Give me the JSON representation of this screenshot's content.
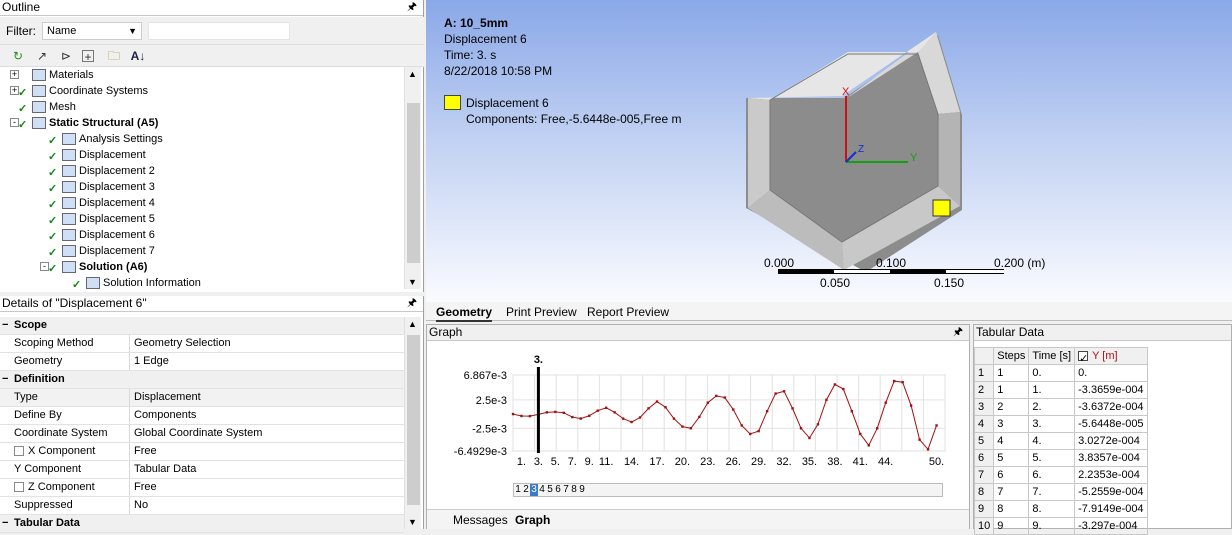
{
  "outline": {
    "title": "Outline",
    "filter_label": "Filter:",
    "filter_value": "Name",
    "tree": [
      {
        "label": "Materials",
        "bold": false,
        "level": 1,
        "expander": "+",
        "check": false
      },
      {
        "label": "Coordinate Systems",
        "bold": false,
        "level": 1,
        "expander": "+",
        "check": true
      },
      {
        "label": "Mesh",
        "bold": false,
        "level": 1,
        "expander": "",
        "check": true
      },
      {
        "label": "Static Structural (A5)",
        "bold": true,
        "level": 1,
        "expander": "-",
        "check": true
      },
      {
        "label": "Analysis Settings",
        "bold": false,
        "level": 2,
        "expander": "",
        "check": true
      },
      {
        "label": "Displacement",
        "bold": false,
        "level": 2,
        "expander": "",
        "check": true
      },
      {
        "label": "Displacement 2",
        "bold": false,
        "level": 2,
        "expander": "",
        "check": true
      },
      {
        "label": "Displacement 3",
        "bold": false,
        "level": 2,
        "expander": "",
        "check": true
      },
      {
        "label": "Displacement 4",
        "bold": false,
        "level": 2,
        "expander": "",
        "check": true
      },
      {
        "label": "Displacement 5",
        "bold": false,
        "level": 2,
        "expander": "",
        "check": true
      },
      {
        "label": "Displacement 6",
        "bold": false,
        "level": 2,
        "expander": "",
        "check": true
      },
      {
        "label": "Displacement 7",
        "bold": false,
        "level": 2,
        "expander": "",
        "check": true
      },
      {
        "label": "Solution (A6)",
        "bold": true,
        "level": 2,
        "expander": "-",
        "check": true
      },
      {
        "label": "Solution Information",
        "bold": false,
        "level": 3,
        "expander": "",
        "check": true
      }
    ]
  },
  "details": {
    "title": "Details of \"Displacement 6\"",
    "rows": [
      {
        "type": "cat",
        "label": "Scope",
        "value": ""
      },
      {
        "type": "row",
        "label": "Scoping Method",
        "value": "Geometry Selection",
        "checkbox": false
      },
      {
        "type": "row",
        "label": "Geometry",
        "value": "1 Edge",
        "checkbox": false
      },
      {
        "type": "cat",
        "label": "Definition",
        "value": ""
      },
      {
        "type": "row",
        "label": "Type",
        "value": "Displacement",
        "checkbox": false
      },
      {
        "type": "row",
        "label": "Define By",
        "value": "Components",
        "checkbox": false
      },
      {
        "type": "row",
        "label": "Coordinate System",
        "value": "Global Coordinate System",
        "checkbox": false
      },
      {
        "type": "row",
        "label": "X Component",
        "value": "Free",
        "checkbox": true
      },
      {
        "type": "row",
        "label": "Y Component",
        "value": "Tabular Data",
        "checkbox": false
      },
      {
        "type": "row",
        "label": "Z Component",
        "value": "Free",
        "checkbox": true
      },
      {
        "type": "row",
        "label": "Suppressed",
        "value": "No",
        "checkbox": false
      },
      {
        "type": "cat",
        "label": "Tabular Data",
        "value": ""
      }
    ]
  },
  "viewport": {
    "model": "A: 10_5mm",
    "object": "Displacement 6",
    "time": "Time: 3. s",
    "date": "8/22/2018 10:58 PM",
    "legend_name": "Displacement 6",
    "legend_components": "Components: Free,-5.6448e-005,Free m",
    "axis_x": "X",
    "axis_y": "Y",
    "axis_z": "Z",
    "scale_top": [
      "0.000",
      "0.100",
      "0.200 (m)"
    ],
    "scale_bottom": [
      "0.050",
      "0.150"
    ],
    "legend_color": "#ffff00"
  },
  "tabs": {
    "geometry": "Geometry",
    "print_preview": "Print Preview",
    "report_preview": "Report Preview"
  },
  "graph": {
    "title": "Graph",
    "cursor_label": "3.",
    "bottom_tabs": {
      "messages": "Messages",
      "graph": "Graph"
    },
    "step_buttons": [
      "1",
      "2",
      "3",
      "4",
      "5",
      "6",
      "7",
      "8",
      "9"
    ],
    "selected_step": "3"
  },
  "chart_data": {
    "type": "line",
    "title": "",
    "xlabel": "",
    "ylabel": "",
    "xlim": [
      0,
      51
    ],
    "ylim": [
      -0.0064929,
      0.006867
    ],
    "ytick_labels": [
      "6.867e-3",
      "2.5e-3",
      "-2.5e-3",
      "-6.4929e-3"
    ],
    "ytick_values": [
      0.006867,
      0.0025,
      -0.0025,
      -0.0064929
    ],
    "xtick_labels": [
      "1.",
      "3.",
      "5.",
      "7.",
      "9.",
      "11.",
      "14.",
      "17.",
      "20.",
      "23.",
      "26.",
      "29.",
      "32.",
      "35.",
      "38.",
      "41.",
      "44.",
      "50."
    ],
    "xtick_values": [
      1,
      3,
      5,
      7,
      9,
      11,
      14,
      17,
      20,
      23,
      26,
      29,
      32,
      35,
      38,
      41,
      44,
      50
    ],
    "cursor_x": 3,
    "series": [
      {
        "color": "#a01010",
        "x": [
          0,
          1,
          2,
          3,
          4,
          5,
          6,
          7,
          8,
          9,
          10,
          11,
          12,
          13,
          14,
          15,
          16,
          17,
          18,
          19,
          20,
          21,
          22,
          23,
          24,
          25,
          26,
          27,
          28,
          29,
          30,
          31,
          32,
          33,
          34,
          35,
          36,
          37,
          38,
          39,
          40,
          41,
          42,
          43,
          44,
          45,
          46,
          47,
          48,
          49,
          50
        ],
        "y": [
          0,
          -0.00034,
          -0.00036,
          -6e-05,
          0.0003,
          0.00038,
          0.00022,
          -0.00053,
          -0.00079,
          -0.0003,
          0.0006,
          0.0011,
          0.0003,
          -0.0008,
          -0.0014,
          -0.0006,
          0.001,
          0.0022,
          0.0012,
          -0.0008,
          -0.0022,
          -0.0025,
          -0.0005,
          0.002,
          0.0032,
          0.0029,
          0.0008,
          -0.002,
          -0.0035,
          -0.003,
          0.0005,
          0.0036,
          0.004,
          0.001,
          -0.0025,
          -0.0042,
          -0.0018,
          0.0025,
          0.0052,
          0.0044,
          0.0005,
          -0.0035,
          -0.0055,
          -0.0025,
          0.002,
          0.0058,
          0.0056,
          0.0015,
          -0.0045,
          -0.0062,
          -0.002
        ]
      }
    ]
  },
  "tabular": {
    "title": "Tabular Data",
    "columns": [
      "Steps",
      "Time [s]",
      "Y [m]"
    ],
    "rows": [
      [
        "1",
        "1",
        "0.",
        "0."
      ],
      [
        "2",
        "1",
        "1.",
        "-3.3659e-004"
      ],
      [
        "3",
        "2",
        "2.",
        "-3.6372e-004"
      ],
      [
        "4",
        "3",
        "3.",
        "-5.6448e-005"
      ],
      [
        "5",
        "4",
        "4.",
        "3.0272e-004"
      ],
      [
        "6",
        "5",
        "5.",
        "3.8357e-004"
      ],
      [
        "7",
        "6",
        "6.",
        "2.2353e-004"
      ],
      [
        "8",
        "7",
        "7.",
        "-5.2559e-004"
      ],
      [
        "9",
        "8",
        "8.",
        "-7.9149e-004"
      ],
      [
        "10",
        "9",
        "9.",
        "-3.297e-004"
      ]
    ]
  }
}
